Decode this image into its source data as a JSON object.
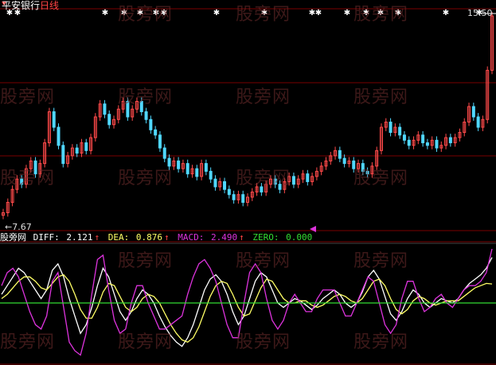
{
  "colors": {
    "background": "#000000",
    "grid": "#7a0000",
    "candle_up": "#ff4a4a",
    "candle_down": "#50d8ff",
    "diff_line": "#ffffff",
    "dea_line": "#ffff66",
    "macd_line": "#dd33dd",
    "zero_line": "#33dd33",
    "watermark": "#6e2d2d"
  },
  "header": {
    "stock_name": "平安银行",
    "period": "日线",
    "price_high": "15.50",
    "price_low": "7.67"
  },
  "indicator_bar": {
    "name": "股旁网",
    "diff_label": "DIFF:",
    "diff_value": "2.121",
    "dea_label": "DEA:",
    "dea_value": "0.876",
    "macd_label": "MACD:",
    "macd_value": "2.490",
    "zero_label": "ZERO:",
    "zero_value": "0.000",
    "arrow": "↑"
  },
  "watermark_text": "股旁网",
  "chart_data": [
    {
      "type": "candlestick",
      "title": "平安银行 日线",
      "ylim": [
        7.67,
        15.5
      ],
      "closes": [
        7.9,
        8.3,
        8.8,
        9.2,
        9.0,
        9.6,
        9.9,
        9.4,
        9.8,
        10.6,
        11.8,
        11.2,
        10.5,
        9.8,
        10.1,
        10.4,
        10.2,
        10.6,
        10.3,
        10.8,
        11.6,
        12.1,
        11.7,
        11.3,
        11.5,
        11.9,
        12.2,
        11.6,
        11.9,
        12.2,
        11.8,
        11.5,
        11.1,
        10.9,
        10.4,
        10.0,
        9.7,
        9.9,
        9.6,
        9.8,
        9.4,
        9.6,
        9.3,
        9.8,
        9.5,
        9.2,
        8.9,
        9.1,
        8.8,
        8.6,
        8.4,
        8.6,
        8.3,
        8.5,
        8.7,
        8.9,
        8.7,
        9.0,
        9.2,
        9.0,
        8.8,
        9.1,
        9.3,
        9.0,
        9.2,
        9.4,
        9.1,
        9.3,
        9.5,
        9.7,
        9.9,
        10.1,
        10.3,
        10.0,
        9.8,
        9.9,
        9.6,
        9.8,
        9.5,
        9.4,
        9.7,
        10.3,
        11.2,
        11.4,
        11.0,
        11.2,
        10.9,
        10.7,
        10.5,
        10.7,
        10.9,
        10.6,
        10.5,
        10.7,
        10.4,
        10.5,
        10.8,
        10.6,
        10.8,
        11.0,
        11.4,
        12.0,
        11.6,
        11.2,
        11.5,
        13.4,
        15.5
      ],
      "markers_top": true
    },
    {
      "type": "line",
      "title": "MACD",
      "series": [
        {
          "name": "DIFF",
          "values": [
            0.4,
            0.8,
            1.2,
            1.6,
            1.4,
            1.0,
            0.6,
            0.2,
            0.6,
            1.5,
            1.8,
            1.2,
            0.2,
            -0.6,
            -1.4,
            -1.0,
            -0.2,
            0.8,
            1.6,
            1.2,
            0.4,
            -0.4,
            -0.8,
            -0.4,
            0.2,
            0.6,
            0.4,
            0.0,
            -0.6,
            -1.1,
            -1.5,
            -1.8,
            -2.0,
            -1.6,
            -1.0,
            -0.2,
            0.6,
            1.1,
            1.3,
            1.0,
            0.4,
            -0.4,
            -1.0,
            -0.6,
            0.2,
            1.0,
            1.4,
            1.2,
            0.6,
            0.0,
            -0.2,
            0.0,
            0.2,
            0.1,
            -0.1,
            -0.3,
            -0.1,
            0.2,
            0.4,
            0.6,
            0.4,
            0.0,
            -0.2,
            0.0,
            0.5,
            1.2,
            1.5,
            1.1,
            0.3,
            -0.5,
            -0.8,
            -0.4,
            0.2,
            0.6,
            0.4,
            0.0,
            -0.2,
            0.0,
            0.2,
            0.1,
            0.0,
            0.2,
            0.6,
            0.9,
            1.1,
            1.3,
            1.6,
            2.1
          ]
        },
        {
          "name": "DEA",
          "values": [
            0.2,
            0.4,
            0.7,
            1.0,
            1.2,
            1.2,
            1.0,
            0.7,
            0.6,
            0.9,
            1.2,
            1.3,
            1.0,
            0.4,
            -0.3,
            -0.7,
            -0.7,
            -0.2,
            0.5,
            0.9,
            0.8,
            0.3,
            -0.2,
            -0.4,
            -0.2,
            0.2,
            0.4,
            0.3,
            0.0,
            -0.5,
            -1.0,
            -1.4,
            -1.7,
            -1.8,
            -1.6,
            -1.1,
            -0.4,
            0.3,
            0.8,
            1.0,
            0.9,
            0.4,
            -0.2,
            -0.6,
            -0.5,
            0.1,
            0.7,
            1.1,
            1.0,
            0.6,
            0.2,
            0.0,
            0.0,
            0.1,
            0.1,
            -0.1,
            -0.2,
            -0.1,
            0.1,
            0.3,
            0.4,
            0.3,
            0.1,
            0.0,
            0.2,
            0.6,
            1.0,
            1.1,
            0.8,
            0.2,
            -0.3,
            -0.5,
            -0.3,
            0.1,
            0.3,
            0.2,
            0.0,
            -0.1,
            0.0,
            0.1,
            0.1,
            0.1,
            0.3,
            0.5,
            0.7,
            0.8,
            0.9,
            0.876
          ]
        },
        {
          "name": "MACD",
          "values": [
            0.8,
            1.4,
            1.6,
            1.2,
            0.4,
            -0.4,
            -1.0,
            -1.2,
            -0.6,
            1.0,
            1.4,
            -0.2,
            -1.8,
            -2.2,
            -2.4,
            -1.4,
            0.4,
            2.0,
            2.2,
            0.6,
            -0.8,
            -1.4,
            -1.2,
            0.0,
            0.8,
            0.8,
            0.0,
            -0.6,
            -1.2,
            -1.2,
            -1.0,
            -0.8,
            -0.6,
            0.4,
            1.2,
            1.8,
            2.0,
            1.6,
            1.0,
            0.0,
            -1.0,
            -1.6,
            -1.6,
            0.0,
            1.4,
            1.8,
            1.4,
            0.2,
            -0.8,
            -1.2,
            -0.8,
            0.0,
            0.4,
            0.0,
            -0.4,
            -0.4,
            0.2,
            0.6,
            0.6,
            0.6,
            0.0,
            -0.6,
            -0.6,
            0.0,
            0.6,
            1.2,
            1.0,
            0.0,
            -1.0,
            -1.4,
            -1.0,
            0.2,
            1.0,
            1.0,
            0.2,
            -0.4,
            -0.2,
            0.2,
            0.4,
            0.0,
            -0.2,
            0.2,
            0.6,
            0.8,
            0.8,
            1.0,
            1.4,
            2.49
          ]
        },
        {
          "name": "ZERO",
          "values": [
            0
          ]
        }
      ]
    }
  ]
}
